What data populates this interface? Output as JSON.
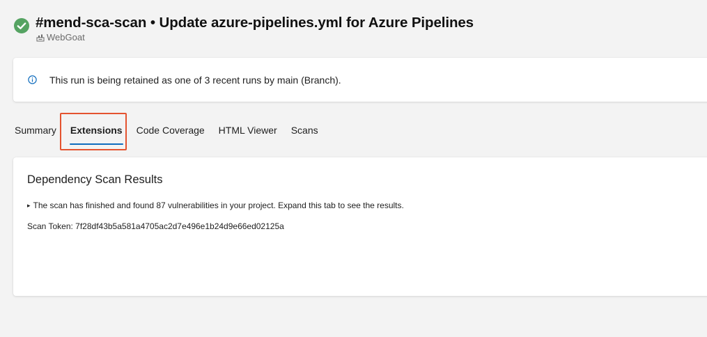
{
  "header": {
    "title": "#mend-sca-scan • Update azure-pipelines.yml for Azure Pipelines",
    "repo": "WebGoat",
    "status": "succeeded",
    "status_color": "#55a362"
  },
  "banner": {
    "icon": "info-icon",
    "text": "This run is being retained as one of 3 recent runs by main (Branch)."
  },
  "tabs": [
    {
      "label": "Summary",
      "selected": false
    },
    {
      "label": "Extensions",
      "selected": true
    },
    {
      "label": "Code Coverage",
      "selected": false
    },
    {
      "label": "HTML Viewer",
      "selected": false
    },
    {
      "label": "Scans",
      "selected": false
    }
  ],
  "extension": {
    "title": "Dependency Scan Results",
    "summary": "The scan has finished and found 87 vulnerabilities in your project. Expand this tab to see the results.",
    "token_line": "Scan Token: 7f28df43b5a581a4705ac2d7e496e1b24d9e66ed02125a"
  },
  "colors": {
    "accent": "#0f6cbd",
    "highlight": "#e4532f",
    "background": "#f3f3f3"
  }
}
